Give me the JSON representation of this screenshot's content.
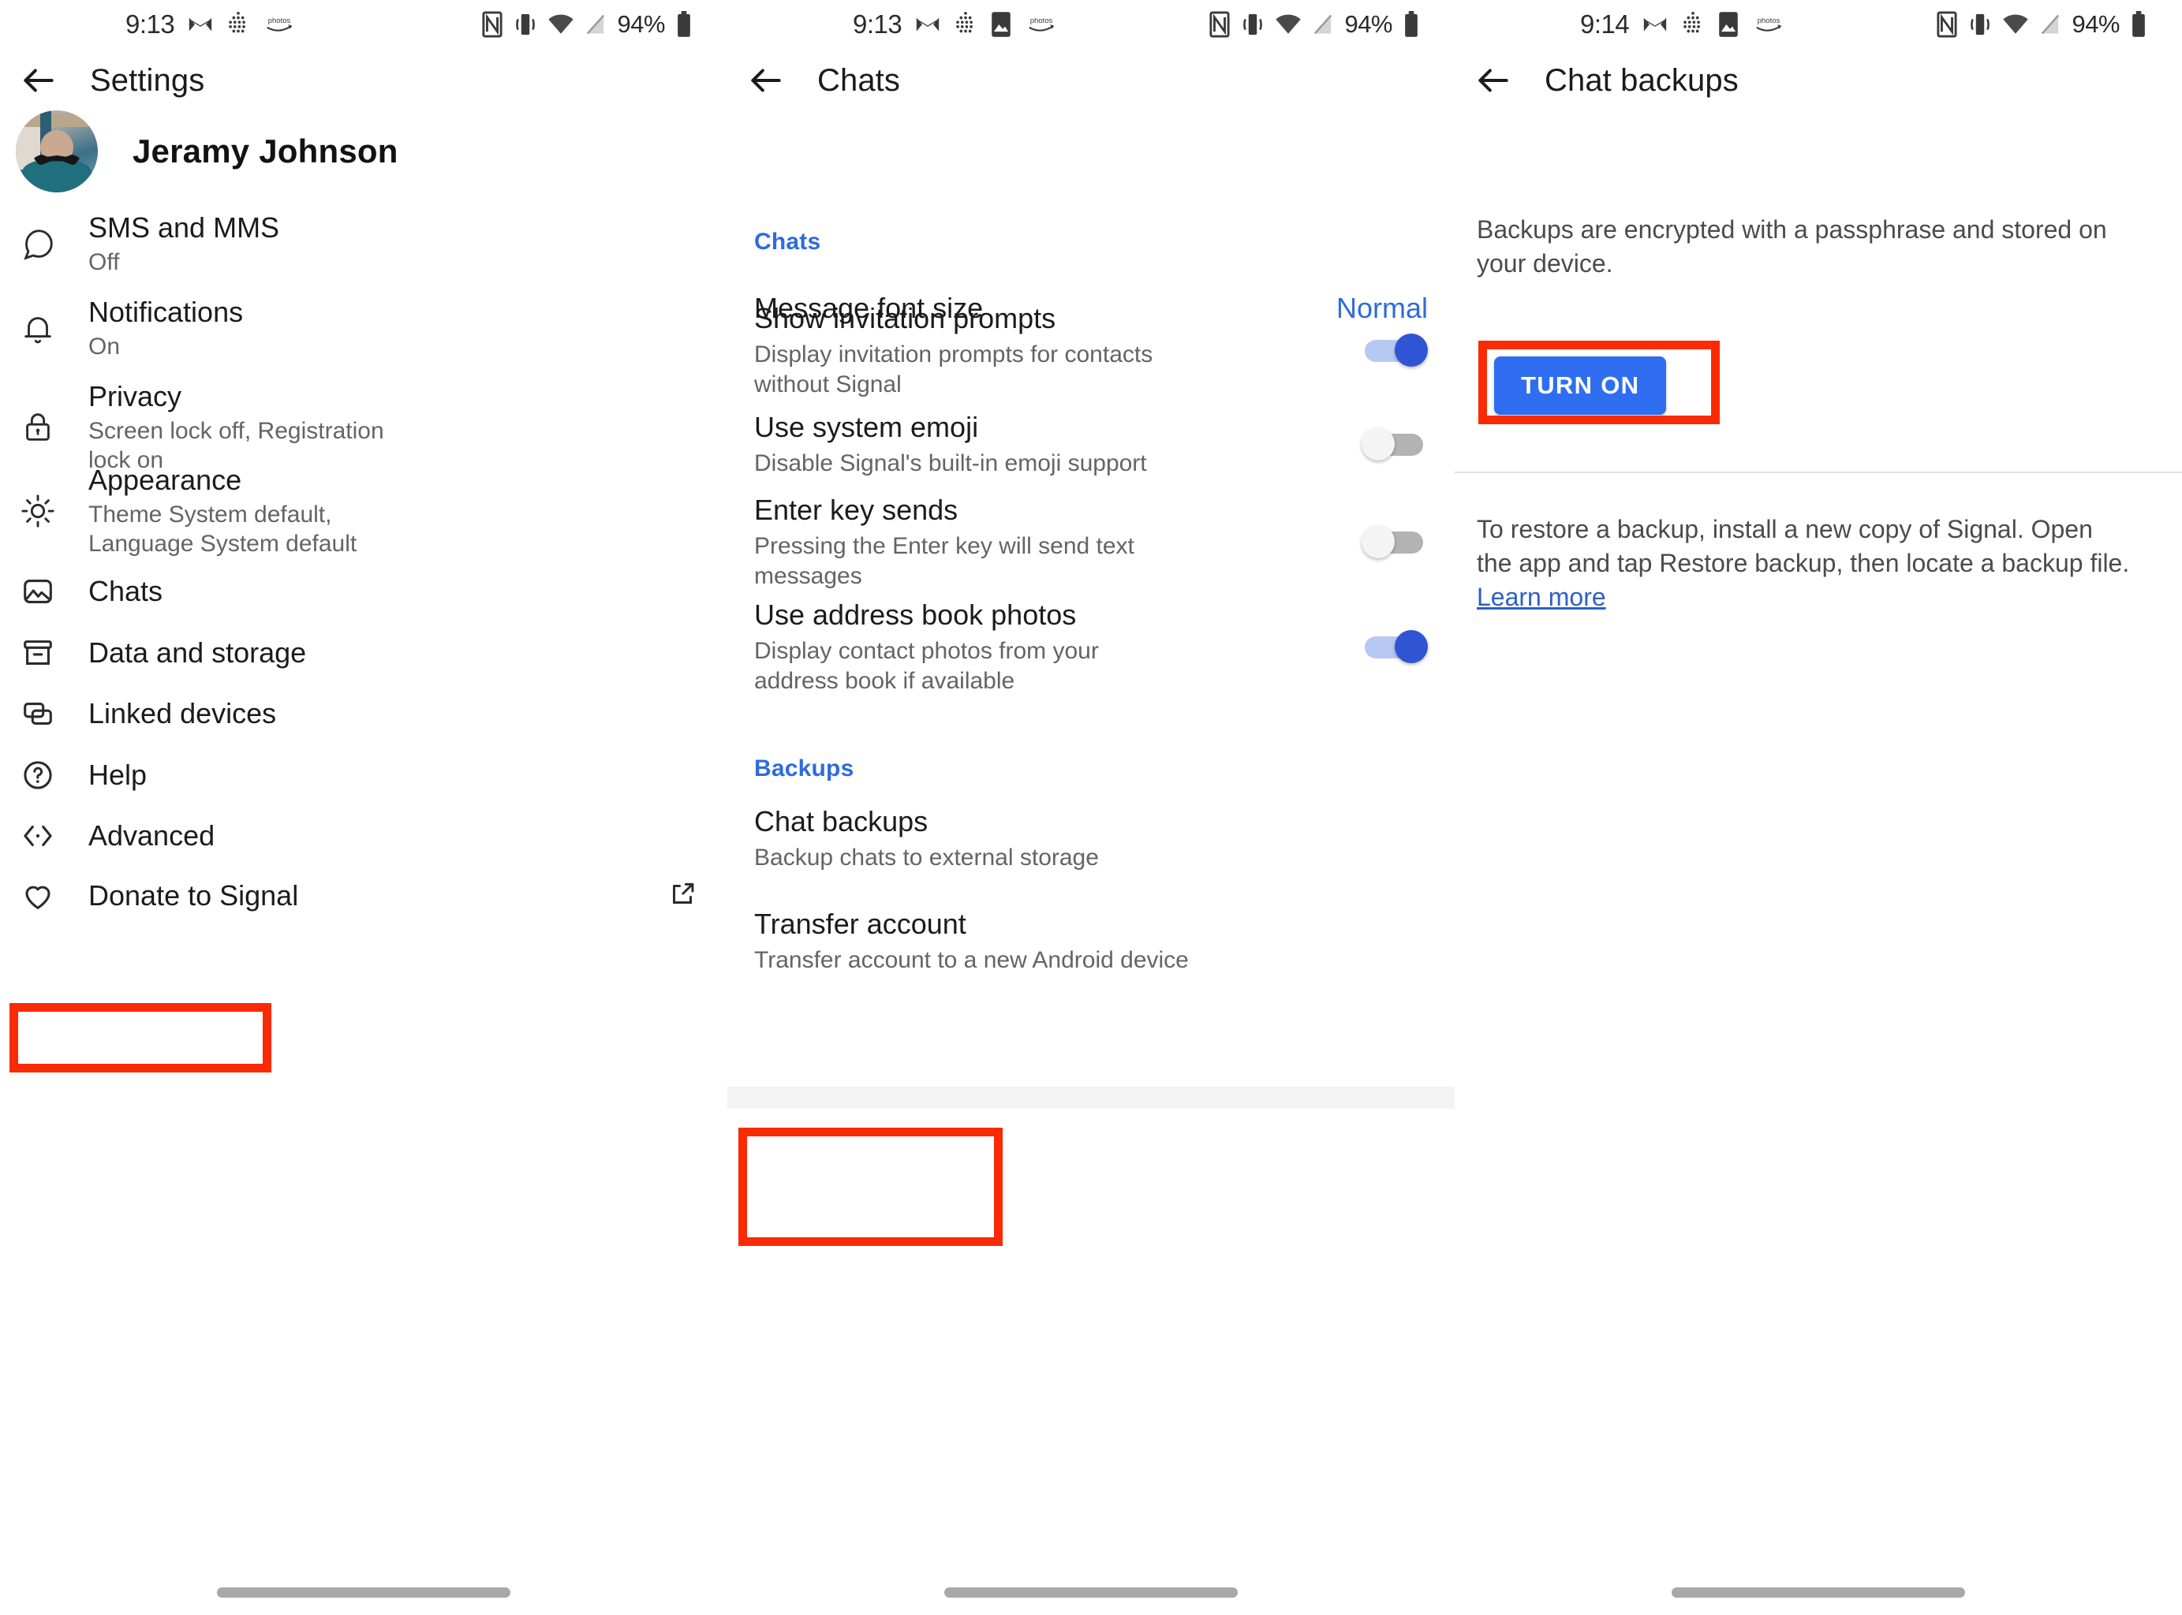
{
  "panels": [
    {
      "statusbar": {
        "time": "9:13",
        "battery": "94%",
        "left_icons": [
          "mail-icon",
          "dots-grid-icon",
          "amazon-photos-icon"
        ],
        "right_icons": [
          "nfc-icon",
          "vibrate-icon",
          "wifi-icon",
          "signal-off-icon",
          "battery-icon"
        ]
      },
      "toolbar": {
        "back": "back-arrow",
        "title": "Settings"
      },
      "profile": {
        "name": "Jeramy Johnson",
        "avatar": "user-avatar-photo"
      },
      "items": [
        {
          "icon": "chat-bubble-icon",
          "title": "SMS and MMS",
          "sub": "Off"
        },
        {
          "icon": "bell-icon",
          "title": "Notifications",
          "sub": "On"
        },
        {
          "icon": "lock-icon",
          "title": "Privacy",
          "sub": "Screen lock off, Registration lock on"
        },
        {
          "icon": "sun-icon",
          "title": "Appearance",
          "sub": "Theme System default, Language System default"
        },
        {
          "icon": "image-icon",
          "title": "Chats",
          "sub": ""
        },
        {
          "icon": "archive-box-icon",
          "title": "Data and storage",
          "sub": ""
        },
        {
          "icon": "linked-devices-icon",
          "title": "Linked devices",
          "sub": ""
        },
        {
          "icon": "help-circle-icon",
          "title": "Help",
          "sub": ""
        },
        {
          "icon": "code-brackets-icon",
          "title": "Advanced",
          "sub": ""
        },
        {
          "icon": "heart-icon",
          "title": "Donate to Signal",
          "sub": "",
          "trailing_icon": "external-link-icon"
        }
      ]
    },
    {
      "statusbar": {
        "time": "9:13",
        "battery": "94%",
        "left_icons": [
          "mail-icon",
          "dots-grid-icon",
          "screenshot-icon",
          "amazon-photos-icon"
        ],
        "right_icons": [
          "nfc-icon",
          "vibrate-icon",
          "wifi-icon",
          "signal-off-icon",
          "battery-icon"
        ]
      },
      "toolbar": {
        "back": "back-arrow",
        "title": "Chats"
      },
      "sections": [
        {
          "header": "Chats",
          "rows": [
            {
              "title": "Message font size",
              "sub": "",
              "value": "Normal",
              "control": "value"
            },
            {
              "title": "Show invitation prompts",
              "sub": "Display invitation prompts for contacts without Signal",
              "control": "toggle",
              "state": "on"
            },
            {
              "title": "Use system emoji",
              "sub": "Disable Signal's built-in emoji support",
              "control": "toggle",
              "state": "off"
            },
            {
              "title": "Enter key sends",
              "sub": "Pressing the Enter key will send text messages",
              "control": "toggle",
              "state": "off"
            },
            {
              "title": "Use address book photos",
              "sub": "Display contact photos from your address book if available",
              "control": "toggle",
              "state": "on"
            }
          ]
        },
        {
          "header": "Backups",
          "rows": [
            {
              "title": "Chat backups",
              "sub": "Backup chats to external storage",
              "control": "none"
            },
            {
              "title": "Transfer account",
              "sub": "Transfer account to a new Android device",
              "control": "none"
            }
          ]
        }
      ]
    },
    {
      "statusbar": {
        "time": "9:14",
        "battery": "94%",
        "left_icons": [
          "mail-icon",
          "dots-grid-icon",
          "screenshot-icon",
          "amazon-photos-icon"
        ],
        "right_icons": [
          "nfc-icon",
          "vibrate-icon",
          "wifi-icon",
          "signal-off-icon",
          "battery-icon"
        ]
      },
      "toolbar": {
        "back": "back-arrow",
        "title": "Chat backups"
      },
      "intro": "Backups are encrypted with a passphrase and stored on your device.",
      "turn_on_label": "TURN ON",
      "restore_text": "To restore a backup, install a new copy of Signal. Open the app and tap Restore backup, then locate a backup file. ",
      "learn_more": "Learn more"
    }
  ],
  "colors": {
    "accent_blue": "#2f6bdd",
    "button_blue": "#2f6ef0",
    "toggle_on_thumb": "#2f55d4",
    "toggle_on_track": "#b7c9f2",
    "annotation_red": "#fa2a05",
    "link_blue": "#2f5fc4",
    "text_primary": "#1b1b1b",
    "text_secondary": "#646464"
  },
  "annotations": [
    {
      "name": "chats-highlight",
      "panel": 1
    },
    {
      "name": "backups-highlight",
      "panel": 2
    },
    {
      "name": "turn-on-highlight",
      "panel": 3
    }
  ]
}
